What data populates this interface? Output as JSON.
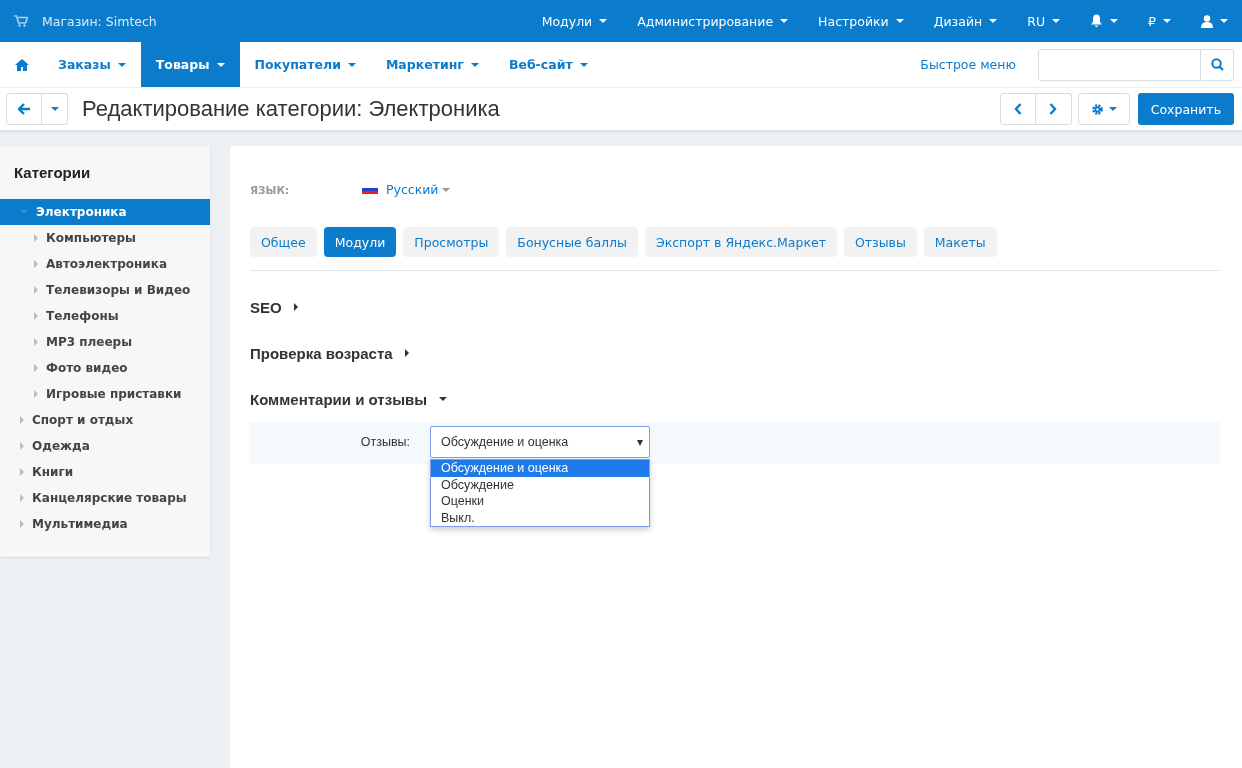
{
  "topbar": {
    "store": "Магазин: Simtech",
    "menus": [
      {
        "label": "Модули"
      },
      {
        "label": "Администрирование"
      },
      {
        "label": "Настройки"
      },
      {
        "label": "Дизайн"
      },
      {
        "label": "RU"
      },
      {
        "kind": "notifications"
      },
      {
        "label": "₽"
      },
      {
        "kind": "account"
      }
    ]
  },
  "nav": {
    "items": [
      {
        "label": "Заказы",
        "selected": false
      },
      {
        "label": "Товары",
        "selected": true
      },
      {
        "label": "Покупатели",
        "selected": false
      },
      {
        "label": "Маркетинг",
        "selected": false
      },
      {
        "label": "Веб-сайт",
        "selected": false
      }
    ],
    "quick_menu": "Быстрое меню"
  },
  "page_title": "Редактирование категории: Электроника",
  "save_button": "Сохранить",
  "sidebar": {
    "title": "Категории",
    "items": [
      {
        "label": "Электроника",
        "selected": true,
        "expanded": true,
        "children": [
          {
            "label": "Компьютеры",
            "selected": false,
            "expanded": false
          },
          {
            "label": "Автоэлектроника",
            "selected": false,
            "expanded": false
          },
          {
            "label": "Телевизоры и Видео",
            "selected": false,
            "expanded": false
          },
          {
            "label": "Телефоны",
            "selected": false,
            "expanded": false
          },
          {
            "label": "MP3 плееры",
            "selected": false,
            "expanded": false
          },
          {
            "label": "Фото видео",
            "selected": false,
            "expanded": false
          },
          {
            "label": "Игровые приставки",
            "selected": false,
            "expanded": false
          }
        ]
      },
      {
        "label": "Спорт и отдых",
        "selected": false,
        "expanded": false
      },
      {
        "label": "Одежда",
        "selected": false,
        "expanded": false
      },
      {
        "label": "Книги",
        "selected": false,
        "expanded": false
      },
      {
        "label": "Канцелярские товары",
        "selected": false,
        "expanded": false
      },
      {
        "label": "Мультимедиа",
        "selected": false,
        "expanded": false
      }
    ]
  },
  "language": {
    "label": "ЯЗЫК:",
    "value": "Русский"
  },
  "tabs": [
    {
      "label": "Общее",
      "selected": false
    },
    {
      "label": "Модули",
      "selected": true
    },
    {
      "label": "Просмотры",
      "selected": false
    },
    {
      "label": "Бонусные баллы",
      "selected": false
    },
    {
      "label": "Экспорт в Яндекс.Маркет",
      "selected": false
    },
    {
      "label": "Отзывы",
      "selected": false
    },
    {
      "label": "Макеты",
      "selected": false
    }
  ],
  "sections": [
    {
      "title": "SEO",
      "expanded": false
    },
    {
      "title": "Проверка возраста",
      "expanded": false
    },
    {
      "title": "Комментарии и отзывы",
      "expanded": true,
      "field": {
        "label": "Отзывы:",
        "value": "Обсуждение и оценка",
        "options": [
          {
            "label": "Обсуждение и оценка",
            "selected": true
          },
          {
            "label": "Обсуждение",
            "selected": false
          },
          {
            "label": "Оценки",
            "selected": false
          },
          {
            "label": "Выкл.",
            "selected": false
          }
        ]
      }
    }
  ]
}
